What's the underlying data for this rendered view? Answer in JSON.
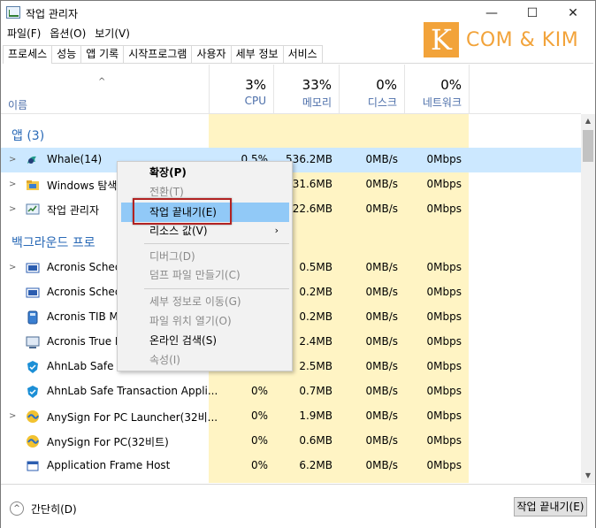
{
  "window": {
    "title": "작업 관리자",
    "controls": {
      "minimize": "—",
      "maximize": "☐",
      "close": "✕"
    }
  },
  "menubar": [
    "파일(F)",
    "옵션(O)",
    "보기(V)"
  ],
  "watermark": {
    "letter": "K",
    "text": "COM & KIM",
    "color": "#f2a33a"
  },
  "tabs": [
    "프로세스",
    "성능",
    "앱 기록",
    "시작프로그램",
    "사용자",
    "세부 정보",
    "서비스"
  ],
  "header": {
    "sort_arrow": "^",
    "name_label": "이름",
    "columns": [
      {
        "pct": "3%",
        "label": "CPU"
      },
      {
        "pct": "33%",
        "label": "메모리"
      },
      {
        "pct": "0%",
        "label": "디스크"
      },
      {
        "pct": "0%",
        "label": "네트워크"
      }
    ]
  },
  "groups": {
    "apps": "앱 (3)",
    "background": "백그라운드 프로"
  },
  "rows": [
    {
      "name": "Whale(14)",
      "cpu": "0.5%",
      "mem": "536.2MB",
      "disk": "0MB/s",
      "net": "0Mbps",
      "icon": "whale-icon",
      "expand": true,
      "highlight": true
    },
    {
      "name": "Windows 탐색기",
      "cpu": "",
      "mem": "31.6MB",
      "disk": "0MB/s",
      "net": "0Mbps",
      "icon": "folder-icon",
      "expand": true
    },
    {
      "name": "작업 관리자",
      "cpu": "",
      "mem": "22.6MB",
      "disk": "0MB/s",
      "net": "0Mbps",
      "icon": "task-manager-icon",
      "expand": true
    },
    {
      "name": "Acronis Schedu",
      "cpu": "",
      "mem": "0.5MB",
      "disk": "0MB/s",
      "net": "0Mbps",
      "icon": "acronis-icon",
      "expand": true
    },
    {
      "name": "Acronis Schedu",
      "cpu": "",
      "mem": "0.2MB",
      "disk": "0MB/s",
      "net": "0Mbps",
      "icon": "acronis-icon",
      "expand": false
    },
    {
      "name": "Acronis TIB Mo",
      "cpu": "",
      "mem": "0.2MB",
      "disk": "0MB/s",
      "net": "0Mbps",
      "icon": "acronis-tib-icon",
      "expand": false
    },
    {
      "name": "Acronis True In",
      "cpu": "",
      "mem": "2.4MB",
      "disk": "0MB/s",
      "net": "0Mbps",
      "icon": "acronis-true-image-icon",
      "expand": false
    },
    {
      "name": "AhnLab Safe Tr",
      "cpu": "",
      "mem": "2.5MB",
      "disk": "0MB/s",
      "net": "0Mbps",
      "icon": "ahnlab-shield-icon",
      "expand": false
    },
    {
      "name": "AhnLab Safe Transaction Appli...",
      "cpu": "0%",
      "mem": "0.7MB",
      "disk": "0MB/s",
      "net": "0Mbps",
      "icon": "ahnlab-shield-icon",
      "expand": false
    },
    {
      "name": "AnySign For PC Launcher(32비...",
      "cpu": "0%",
      "mem": "1.9MB",
      "disk": "0MB/s",
      "net": "0Mbps",
      "icon": "anysign-icon",
      "expand": true
    },
    {
      "name": "AnySign For PC(32비트)",
      "cpu": "0%",
      "mem": "0.6MB",
      "disk": "0MB/s",
      "net": "0Mbps",
      "icon": "anysign-icon",
      "expand": false
    },
    {
      "name": "Application Frame Host",
      "cpu": "0%",
      "mem": "6.2MB",
      "disk": "0MB/s",
      "net": "0Mbps",
      "icon": "app-frame-icon",
      "expand": false
    }
  ],
  "context_menu": {
    "items": [
      {
        "label": "확장(P)",
        "bold": true,
        "disabled": false
      },
      {
        "label": "전환(T)",
        "disabled": true
      },
      {
        "label": "작업 끝내기(E)",
        "disabled": false,
        "highlighted": true
      },
      {
        "label": "리소스 값(V)",
        "disabled": false,
        "submenu": "›"
      },
      {
        "label": "디버그(D)",
        "disabled": true
      },
      {
        "label": "덤프 파일 만들기(C)",
        "disabled": true
      },
      {
        "label": "세부 정보로 이동(G)",
        "disabled": true
      },
      {
        "label": "파일 위치 열기(O)",
        "disabled": true
      },
      {
        "label": "온라인 검색(S)",
        "disabled": false
      },
      {
        "label": "속성(I)",
        "disabled": true
      }
    ]
  },
  "footer": {
    "fewer_icon": "^",
    "fewer_label": "간단히(D)",
    "end_task_label": "작업 끝내기(E)"
  },
  "scrollbar": {
    "up": "▲",
    "down": "▼"
  }
}
